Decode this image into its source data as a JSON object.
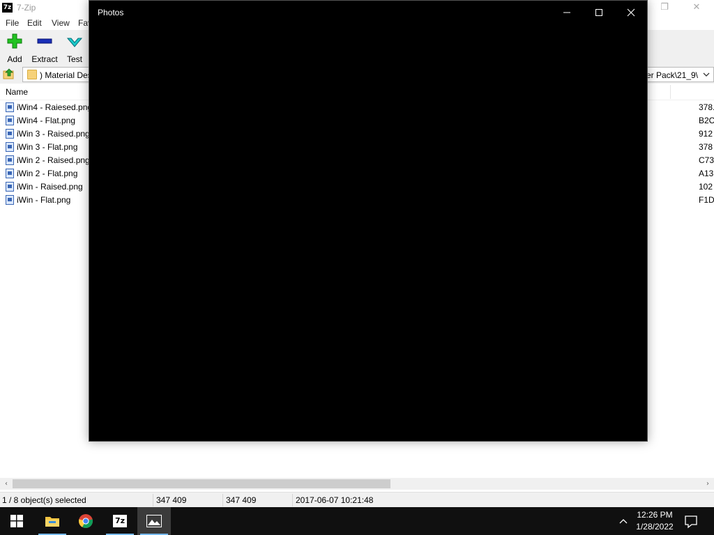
{
  "zip": {
    "title": "7-Zip",
    "app_icon_text": "7z",
    "menu": [
      "File",
      "Edit",
      "View",
      "Fav"
    ],
    "toolbar": {
      "add": "Add",
      "extract": "Extract",
      "test": "Test"
    },
    "address_left": ") Material Des",
    "address_right": "per Pack\\21_9\\",
    "column_name": "Name",
    "files": [
      {
        "name": "iWin4 - Raiesed.png",
        "value": "378."
      },
      {
        "name": "iWin4 - Flat.png",
        "value": "B2C"
      },
      {
        "name": "iWin 3 - Raised.png",
        "value": "912"
      },
      {
        "name": "iWin 3 - Flat.png",
        "value": "378"
      },
      {
        "name": "iWin 2 - Raised.png",
        "value": "C73"
      },
      {
        "name": "iWin 2 - Flat.png",
        "value": "A13"
      },
      {
        "name": "iWin - Raised.png",
        "value": "102"
      },
      {
        "name": "iWin - Flat.png",
        "value": "F1D"
      }
    ],
    "status": {
      "selection": "1 / 8 object(s) selected",
      "size": "347 409",
      "packed": "347 409",
      "modified": "2017-06-07 10:21:48"
    }
  },
  "photos": {
    "title": "Photos"
  },
  "taskbar": {
    "time": "12:26 PM",
    "date": "1/28/2022",
    "icons": [
      "windows-start-icon",
      "file-explorer-icon",
      "chrome-icon",
      "7zip-icon",
      "photos-icon"
    ]
  },
  "colors": {
    "accent": "#76b9ed",
    "taskbar": "#101010",
    "photos_bg": "#000000"
  }
}
